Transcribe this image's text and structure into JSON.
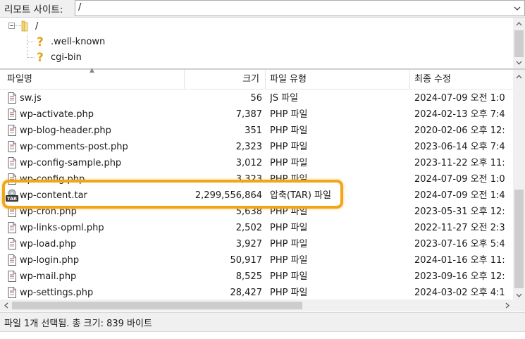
{
  "sitebar": {
    "label": "리모트 사이트:",
    "path": "/"
  },
  "tree": {
    "root": "/",
    "children": [
      ".well-known",
      "cgi-bin"
    ]
  },
  "columns": {
    "name": "파일명",
    "size": "크기",
    "type": "파일 유형",
    "modified": "최종 수정"
  },
  "files": [
    {
      "name": "sw.js",
      "size": "56",
      "type": "JS 파일",
      "modified": "2024-07-09 오전 1:0",
      "icon": "file-icon"
    },
    {
      "name": "wp-activate.php",
      "size": "7,387",
      "type": "PHP 파일",
      "modified": "2024-02-13 오후 7:4",
      "icon": "file-icon"
    },
    {
      "name": "wp-blog-header.php",
      "size": "351",
      "type": "PHP 파일",
      "modified": "2020-02-06 오후 12:",
      "icon": "file-icon"
    },
    {
      "name": "wp-comments-post.php",
      "size": "2,323",
      "type": "PHP 파일",
      "modified": "2023-06-14 오후 7:4",
      "icon": "file-icon"
    },
    {
      "name": "wp-config-sample.php",
      "size": "3,012",
      "type": "PHP 파일",
      "modified": "2023-11-22 오후 11:",
      "icon": "file-icon"
    },
    {
      "name": "wp-config.php",
      "size": "3,323",
      "type": "PHP 파일",
      "modified": "2024-07-09 오전 1:0",
      "icon": "file-icon"
    },
    {
      "name": "wp-content.tar",
      "size": "2,299,556,864",
      "type": "압축(TAR) 파일",
      "modified": "2024-07-09 오전 1:4",
      "icon": "tar-archive-icon",
      "highlighted": true
    },
    {
      "name": "wp-cron.php",
      "size": "5,638",
      "type": "PHP 파일",
      "modified": "2023-05-31 오후 12:",
      "icon": "file-icon"
    },
    {
      "name": "wp-links-opml.php",
      "size": "2,502",
      "type": "PHP 파일",
      "modified": "2022-11-27 오전 2:3",
      "icon": "file-icon"
    },
    {
      "name": "wp-load.php",
      "size": "3,927",
      "type": "PHP 파일",
      "modified": "2023-07-16 오후 5:4",
      "icon": "file-icon"
    },
    {
      "name": "wp-login.php",
      "size": "50,917",
      "type": "PHP 파일",
      "modified": "2024-01-16 오후 11:",
      "icon": "file-icon"
    },
    {
      "name": "wp-mail.php",
      "size": "8,525",
      "type": "PHP 파일",
      "modified": "2023-09-16 오후 12:",
      "icon": "file-icon"
    },
    {
      "name": "wp-settings.php",
      "size": "28,427",
      "type": "PHP 파일",
      "modified": "2024-03-02 오후 4:1",
      "icon": "file-icon"
    }
  ],
  "status": {
    "text": "파일 1개 선택됨. 총 크기: 839 바이트"
  },
  "colors": {
    "highlight": "#f2a516",
    "unknown_icon": "#e8a317"
  }
}
